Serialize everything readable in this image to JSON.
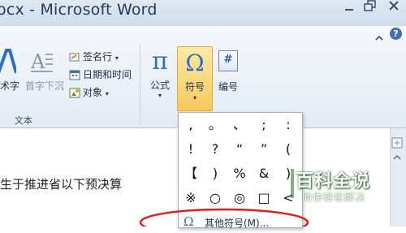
{
  "window": {
    "title": "ocx - Microsoft Word",
    "minimize_icon": "minimize-icon",
    "restore_icon": "restore-icon",
    "close_icon": "close-icon"
  },
  "ribbon": {
    "collapse_icon": "chevron-up-icon",
    "help_label": "?",
    "text_group": {
      "label": "文本",
      "wordart_label": "术字",
      "dropcap_label": "首字下沉",
      "signature_line_label": "签名行",
      "datetime_label": "日期和时间",
      "object_label": "对象"
    },
    "symbols_group": {
      "equation_label": "公式",
      "equation_glyph": "π",
      "symbol_label": "符号",
      "symbol_glyph": "Ω",
      "number_label": "编号",
      "number_glyph": "#"
    }
  },
  "document": {
    "body_text": "生于推进省以下预决算"
  },
  "symbol_palette": {
    "rows": [
      [
        ",",
        "。",
        "、",
        ";",
        ":"
      ],
      [
        "!",
        "?",
        "“",
        "”",
        "("
      ],
      [
        "【",
        ")",
        "%",
        "&",
        ")"
      ],
      [
        "※",
        "○",
        "◎",
        "□",
        "<"
      ]
    ],
    "more_symbols_label": "其他符号(M)...",
    "more_symbols_glyph": "Ω"
  },
  "watermark": {
    "title": "百科全说",
    "subtitle": "助你轻松解决"
  },
  "colors": {
    "accent_highlight": "#fbd76a",
    "annotation_red": "#e0201c",
    "watermark_green": "#2c6a2c"
  }
}
